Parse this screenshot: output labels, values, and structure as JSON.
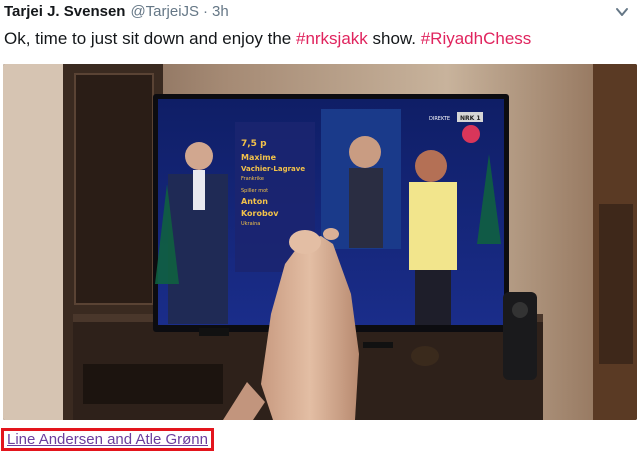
{
  "tweet": {
    "author_name": "Tarjei J. Svensen",
    "author_handle": "@TarjeiJS",
    "separator": "·",
    "time": "3h",
    "text_prefix": "Ok, time to just sit down and enjoy the ",
    "hashtag_1": "#nrksjakk",
    "text_middle": " show. ",
    "hashtag_2": "#RiyadhChess"
  },
  "tv_overlay": {
    "rank": "7,5 p",
    "player1_first": "Maxime",
    "player1_last": "Vachier-Lagrave",
    "player1_country": "Frankrike",
    "vs": "Spiller mot",
    "player2_first": "Anton",
    "player2_last": "Korobov",
    "player2_country": "Ukraina",
    "live": "DIREKTE",
    "channel": "NRK 1"
  },
  "caption": {
    "text": "Line Andersen and Atle Grønn"
  },
  "colors": {
    "hashtag": "#e0245e",
    "handle": "#657786",
    "caption_border": "#e3151d",
    "caption_text": "#6b3e9e"
  },
  "icons": {
    "caret": "chevron-down-icon"
  }
}
